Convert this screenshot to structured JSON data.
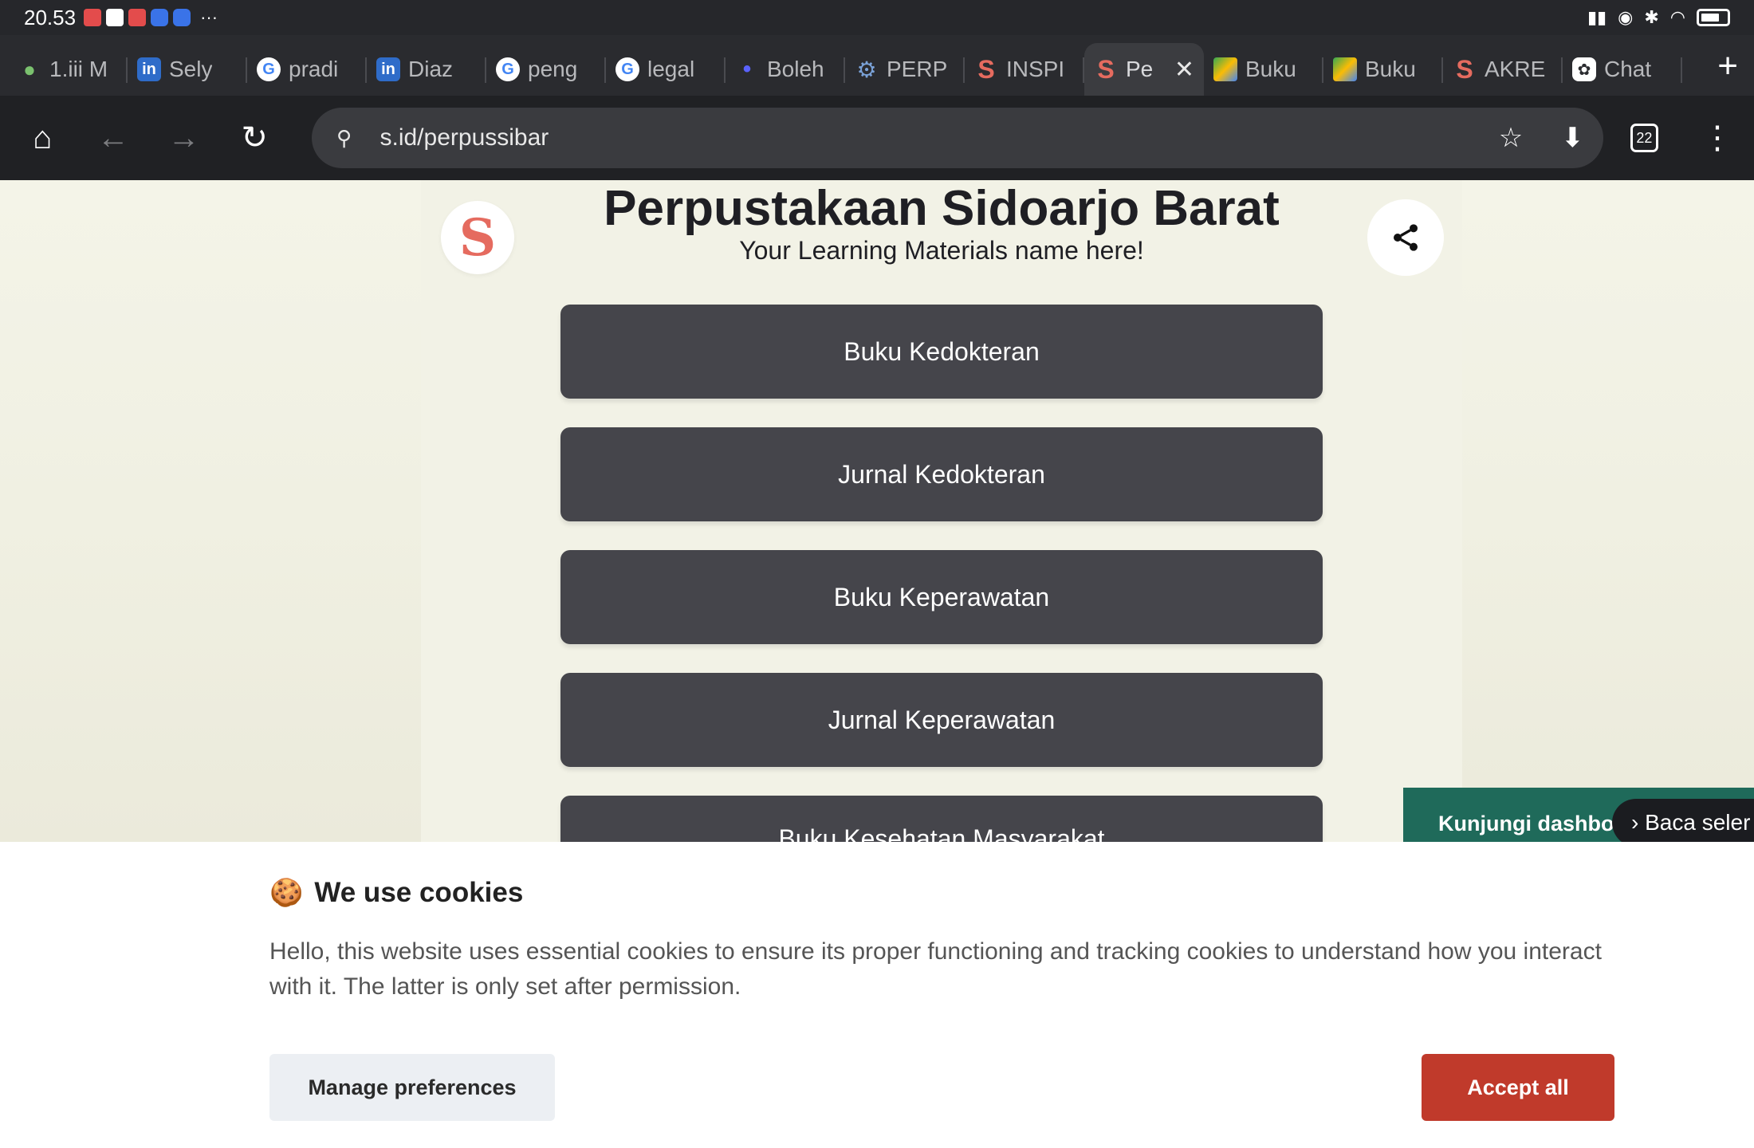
{
  "status_bar": {
    "time": "20.53",
    "more": "···"
  },
  "tabs": [
    {
      "label": "1.iii M",
      "icon": "leaf-icon"
    },
    {
      "label": "Sely",
      "icon": "linkedin-icon"
    },
    {
      "label": "pradi",
      "icon": "google-icon"
    },
    {
      "label": "Diaz",
      "icon": "linkedin-icon"
    },
    {
      "label": "peng",
      "icon": "google-icon"
    },
    {
      "label": "legal",
      "icon": "google-icon"
    },
    {
      "label": "Boleh",
      "icon": "dot-icon"
    },
    {
      "label": "PERP",
      "icon": "gear-icon"
    },
    {
      "label": "INSPI",
      "icon": "s-link-icon"
    },
    {
      "label": "Pe",
      "icon": "s-link-icon",
      "active": true
    },
    {
      "label": "Buku",
      "icon": "drive-icon"
    },
    {
      "label": "Buku",
      "icon": "drive-icon"
    },
    {
      "label": "AKRE",
      "icon": "s-link-icon"
    },
    {
      "label": "Chat",
      "icon": "chatgpt-icon"
    }
  ],
  "address_bar": {
    "url": "s.id/perpussibar",
    "tab_count": "22"
  },
  "page": {
    "title": "Perpustakaan Sidoarjo Barat",
    "subtitle": "Your Learning Materials name here!",
    "links": [
      "Buku Kedokteran",
      "Jurnal Kedokteran",
      "Buku Keperawatan",
      "Jurnal Keperawatan",
      "Buku Kesehatan Masyarakat"
    ],
    "promo_text": "Kunjungi dashboard",
    "promo_pill": "› Baca seler"
  },
  "cookie_banner": {
    "title": "We use cookies",
    "description": "Hello, this website uses essential cookies to ensure its proper functioning and tracking cookies to understand how you interact with it. The latter is only set after permission.",
    "manage_label": "Manage preferences",
    "accept_label": "Accept all"
  },
  "colors": {
    "accept_button": "#c03a2b",
    "link_button": "#45454b",
    "brand_s": "#e56b5f",
    "promo_bg": "#1f6a5a"
  }
}
